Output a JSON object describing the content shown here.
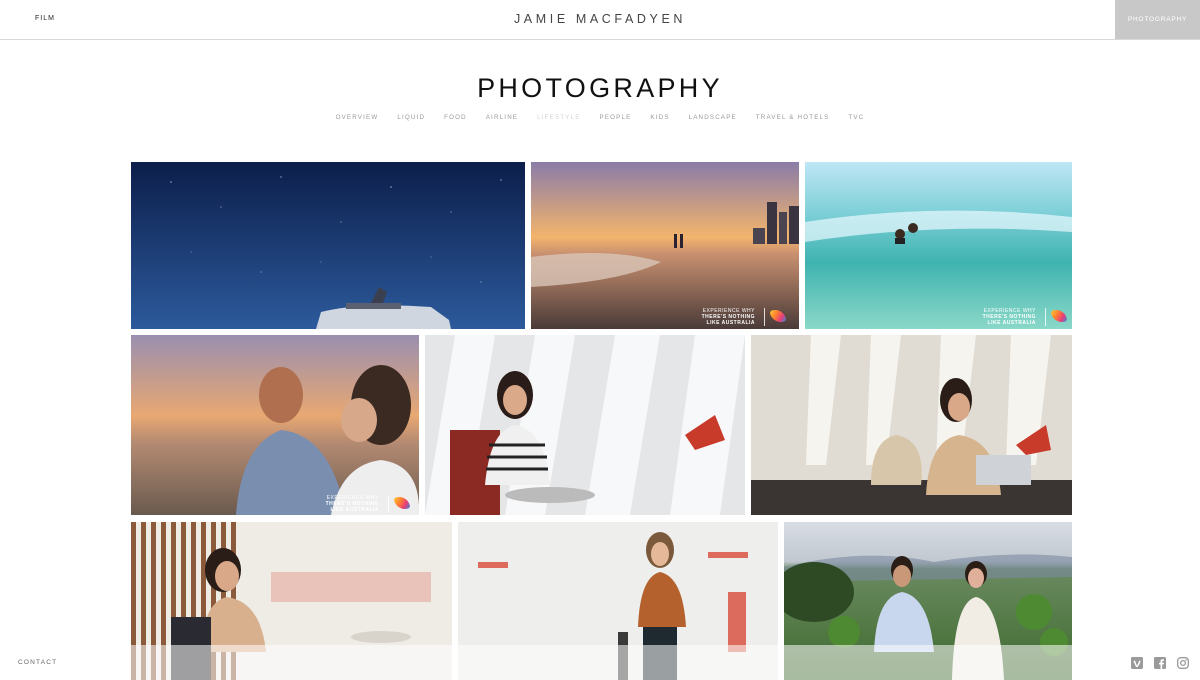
{
  "header": {
    "film_label": "FILM",
    "site_title": "JAMIE MACFADYEN",
    "photography_tab": "PHOTOGRAPHY"
  },
  "page": {
    "title": "PHOTOGRAPHY",
    "categories": [
      {
        "label": "OVERVIEW",
        "active": false
      },
      {
        "label": "LIQUID",
        "active": false
      },
      {
        "label": "FOOD",
        "active": false
      },
      {
        "label": "AIRLINE",
        "active": false
      },
      {
        "label": "LIFESTYLE",
        "active": true
      },
      {
        "label": "PEOPLE",
        "active": false
      },
      {
        "label": "KIDS",
        "active": false
      },
      {
        "label": "LANDSCAPE",
        "active": false
      },
      {
        "label": "TRAVEL & HOTELS",
        "active": false
      },
      {
        "label": "TVC",
        "active": false
      }
    ]
  },
  "watermark": {
    "line1": "EXPERIENCE WHY",
    "line2": "THERE'S NOTHING",
    "line3": "LIKE AUSTRALIA"
  },
  "footer": {
    "contact_label": "CONTACT",
    "social_icons": [
      "vimeo-icon",
      "facebook-icon",
      "instagram-icon"
    ]
  },
  "colors": {
    "active_tab_bg": "#c8c8c8",
    "nav_text": "#999999",
    "active_category": "#d3d3d3"
  }
}
